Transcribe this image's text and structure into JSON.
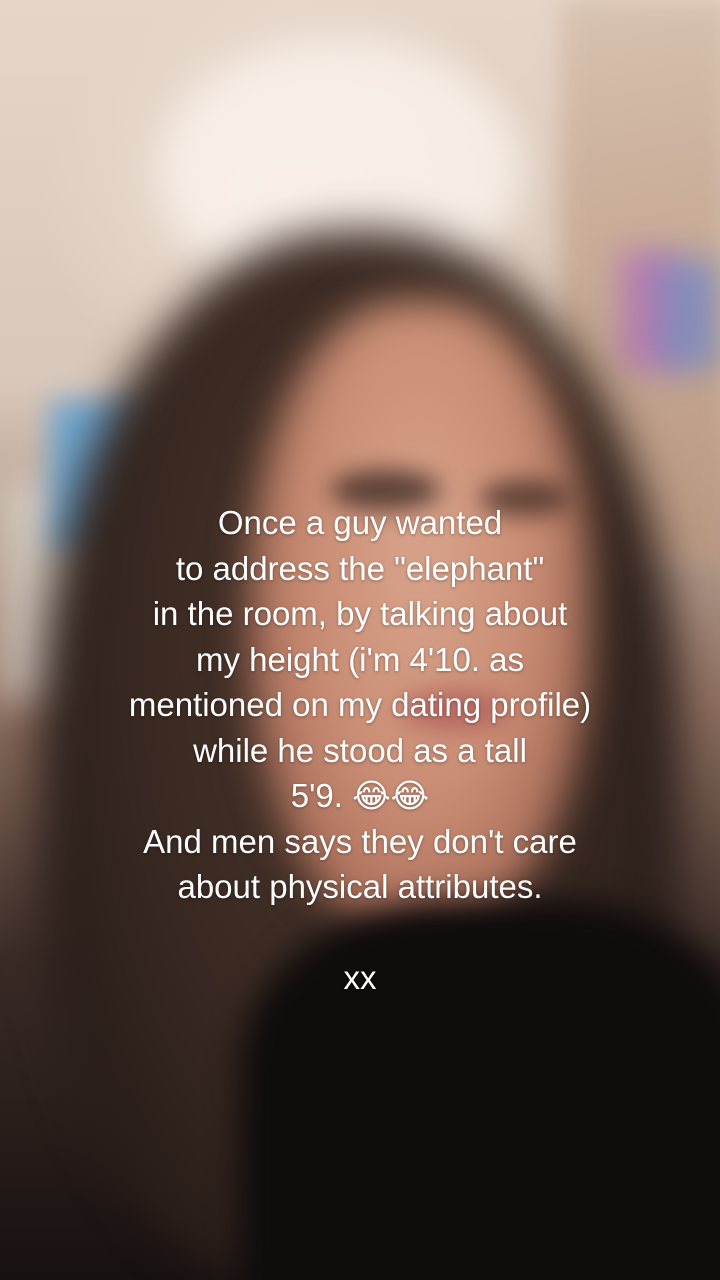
{
  "caption": {
    "lines": [
      "Once a guy wanted",
      "to address the \"elephant\"",
      "in the room, by talking about",
      "my height (i'm 4'10. as",
      "mentioned on my dating profile)",
      "while he stood as a tall",
      "5'9. 😂😂",
      "And men says they don't care",
      "about physical attributes.",
      "",
      "xx"
    ]
  }
}
